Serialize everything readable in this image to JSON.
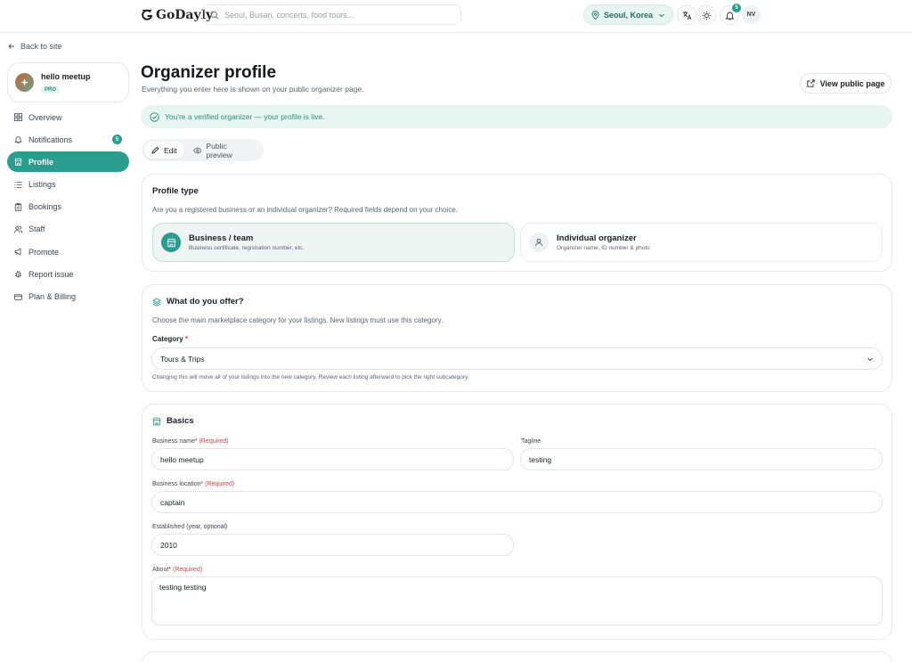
{
  "header": {
    "logo_text": "GoDayly",
    "search_placeholder": "Seoul, Busan, concerts, food tours...",
    "location_label": "Seoul, Korea",
    "notification_count": "5",
    "user_initials": "NV"
  },
  "sidebar": {
    "back_label": "Back to site",
    "org_name": "hello meetup",
    "org_plan": "PRO",
    "items": [
      {
        "label": "Overview",
        "icon": "grid-icon"
      },
      {
        "label": "Notifications",
        "icon": "bell-icon",
        "badge": "5"
      },
      {
        "label": "Profile",
        "icon": "store-icon",
        "active": true
      },
      {
        "label": "Listings",
        "icon": "list-icon"
      },
      {
        "label": "Bookings",
        "icon": "clipboard-icon"
      },
      {
        "label": "Staff",
        "icon": "users-icon"
      },
      {
        "label": "Promote",
        "icon": "megaphone-icon"
      },
      {
        "label": "Report issue",
        "icon": "bug-icon"
      },
      {
        "label": "Plan & Billing",
        "icon": "card-icon"
      }
    ]
  },
  "main": {
    "title": "Organizer profile",
    "subtitle": "Everything you enter here is shown on your public organizer page.",
    "view_public_label": "View public page",
    "verified_text": "You're a verified organizer — your profile is live.",
    "tabs": [
      {
        "label": "Edit",
        "active": true
      },
      {
        "label": "Public preview",
        "active": false
      }
    ]
  },
  "profile_type": {
    "title": "Profile type",
    "description": "Are you a registered business or an individual organizer? Required fields depend on your choice.",
    "options": [
      {
        "label": "Business / team",
        "sub": "Business certificate, registration number, etc.",
        "selected": true
      },
      {
        "label": "Individual organizer",
        "sub": "Organizer name, ID number & photo",
        "selected": false
      }
    ]
  },
  "offer": {
    "title": "What do you offer?",
    "description": "Choose the main marketplace category for your listings. New listings must use this category.",
    "category_label": "Category",
    "category_required": "*",
    "category_value": "Tours & Trips",
    "helper": "Changing this will move all of your listings into the new category. Review each listing afterward to pick the right subcategory."
  },
  "basics": {
    "title": "Basics",
    "business_name_label": "Business name*",
    "business_name_req": "(Required)",
    "business_name_value": "hello meetup",
    "tagline_label": "Tagline",
    "tagline_value": "testing",
    "location_label": "Business location*",
    "location_req": "(Required)",
    "location_value": "captain",
    "established_label": "Established (year, optional)",
    "established_value": "2010",
    "about_label": "About*",
    "about_req": "(Required)",
    "about_value": "testing testing"
  },
  "colors": {
    "accent": "#2a9d8f",
    "verified_bg": "#e7f5f0",
    "required": "#d64545"
  }
}
